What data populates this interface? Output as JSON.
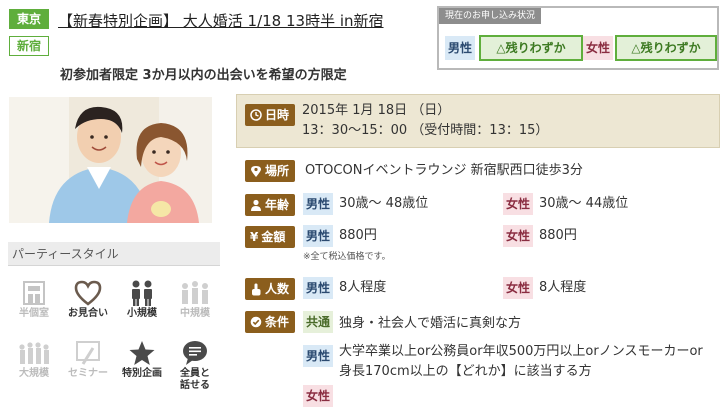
{
  "header": {
    "area_tag": "東京",
    "station_tag": "新宿",
    "title": "【新春特別企画】 大人婚活 1/18 13時半 in新宿",
    "subtitle": "初参加者限定 3か月以内の出会いを希望の方限定"
  },
  "status": {
    "heading": "現在のお申し込み状況",
    "male_label": "男性",
    "male_status": "△残りわずか",
    "female_label": "女性",
    "female_status": "△残りわずか"
  },
  "party_style": {
    "heading": "パーティースタイル",
    "items": [
      {
        "label": "半個室",
        "icon": "private-room-icon",
        "active": false
      },
      {
        "label": "お見合い",
        "icon": "heart-icon",
        "active": true
      },
      {
        "label": "小規模",
        "icon": "small-group-icon",
        "active": true
      },
      {
        "label": "中規模",
        "icon": "medium-group-icon",
        "active": false
      },
      {
        "label": "大規模",
        "icon": "large-group-icon",
        "active": false
      },
      {
        "label": "セミナー",
        "icon": "seminar-icon",
        "active": false
      },
      {
        "label": "特別企画",
        "icon": "star-icon",
        "active": true
      },
      {
        "label": "全員と\n話せる",
        "icon": "chat-icon",
        "active": true
      }
    ]
  },
  "details": {
    "datetime_label": "日時",
    "date": "2015年 1月 18日 （日）",
    "time": "13：30〜15：00 （受付時間：13：15）",
    "venue_label": "場所",
    "venue": "OTOCONイベントラウンジ 新宿駅西口徒歩3分",
    "age_label": "年齢",
    "male": "男性",
    "female": "女性",
    "common": "共通",
    "male_age": "30歳〜 48歳位",
    "female_age": "30歳〜 44歳位",
    "price_label": "金額",
    "male_price": "880円",
    "female_price": "880円",
    "price_note": "※全て税込価格です。",
    "count_label": "人数",
    "male_count": "8人程度",
    "female_count": "8人程度",
    "cond_label": "条件",
    "common_cond": "独身・社会人で婚活に真剣な方",
    "male_cond_1": "大学卒業以上or公務員or年収500万円以上orノンスモーカーor",
    "male_cond_2": "身長170cm以上の【どれか】に該当する方"
  },
  "colors": {
    "accent_green": "#5fae3c",
    "label_brown": "#8b5e1d",
    "male_bg": "#d9e9f6",
    "female_bg": "#f8dfe3"
  }
}
